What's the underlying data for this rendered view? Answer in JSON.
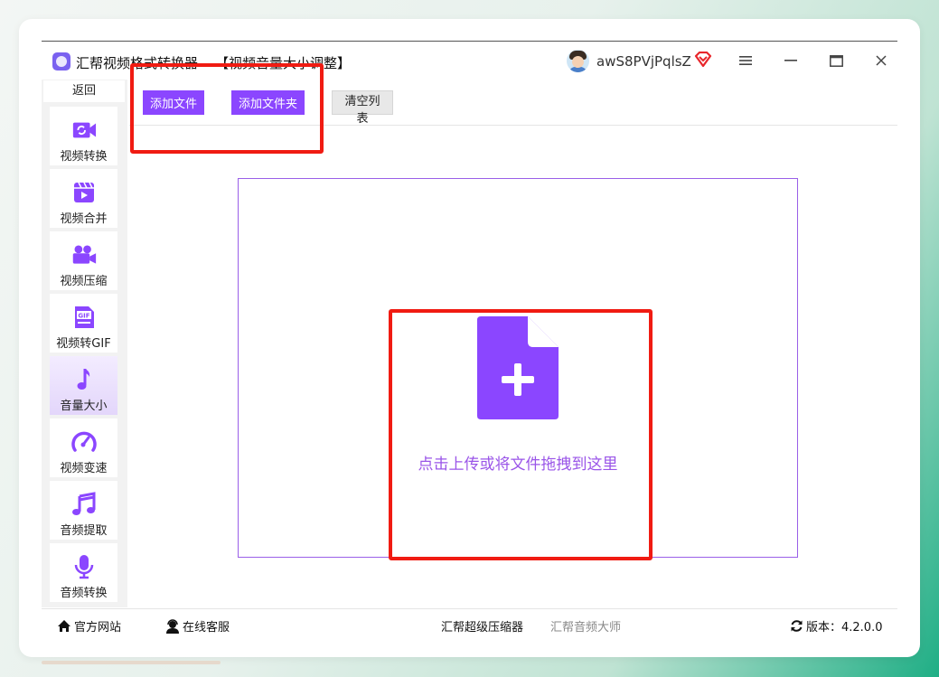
{
  "window": {
    "app_title": "汇帮视频格式转换器",
    "module_title": "【视频音量大小调整】",
    "username": "awS8PVjPqlsZ"
  },
  "sidebar": {
    "back_label": "返回",
    "items": [
      {
        "label": "视频转换",
        "icon": "video-convert-icon"
      },
      {
        "label": "视频合并",
        "icon": "video-merge-icon"
      },
      {
        "label": "视频压缩",
        "icon": "video-compress-icon"
      },
      {
        "label": "视频转GIF",
        "icon": "gif-icon"
      },
      {
        "label": "音量大小",
        "icon": "music-note-icon",
        "active": true
      },
      {
        "label": "视频变速",
        "icon": "speedometer-icon"
      },
      {
        "label": "音频提取",
        "icon": "music-notes-icon"
      },
      {
        "label": "音频转换",
        "icon": "microphone-icon"
      }
    ]
  },
  "toolbar": {
    "add_file": "添加文件",
    "add_folder": "添加文件夹",
    "clear_list": "清空列表"
  },
  "dropzone": {
    "text": "点击上传或将文件拖拽到这里"
  },
  "footer": {
    "website": "官方网站",
    "service": "在线客服",
    "compressor": "汇帮超级压缩器",
    "audio_master": "汇帮音频大师",
    "version_label": "版本：4.2.0.0"
  },
  "colors": {
    "accent": "#8b46ff",
    "highlight": "#f01b12"
  }
}
